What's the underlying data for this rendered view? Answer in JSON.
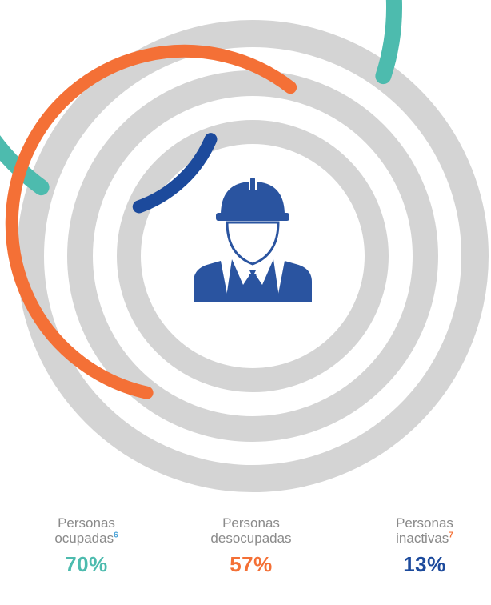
{
  "chart_data": {
    "type": "radial-bar",
    "series": [
      {
        "name": "Personas ocupadas",
        "footnote": "6",
        "value": 70,
        "display": "70%",
        "color": "#4dbbae"
      },
      {
        "name": "Personas desocupadas",
        "footnote": "",
        "value": 57,
        "display": "57%",
        "color": "#f47036"
      },
      {
        "name": "Personas inactivas",
        "footnote": "7",
        "value": 13,
        "display": "13%",
        "color": "#1c4a9c"
      }
    ],
    "max": 100,
    "track_color": "#d4d4d4",
    "center_icon": "construction-worker-icon",
    "icon_color": "#2a54a0",
    "legend": [
      {
        "line1": "Personas",
        "line2": "ocupadas",
        "sup": "6",
        "value": "70%"
      },
      {
        "line1": "Personas",
        "line2": "desocupadas",
        "sup": "",
        "value": "57%"
      },
      {
        "line1": "Personas",
        "line2": "inactivas",
        "sup": "7",
        "value": "13%"
      }
    ]
  }
}
